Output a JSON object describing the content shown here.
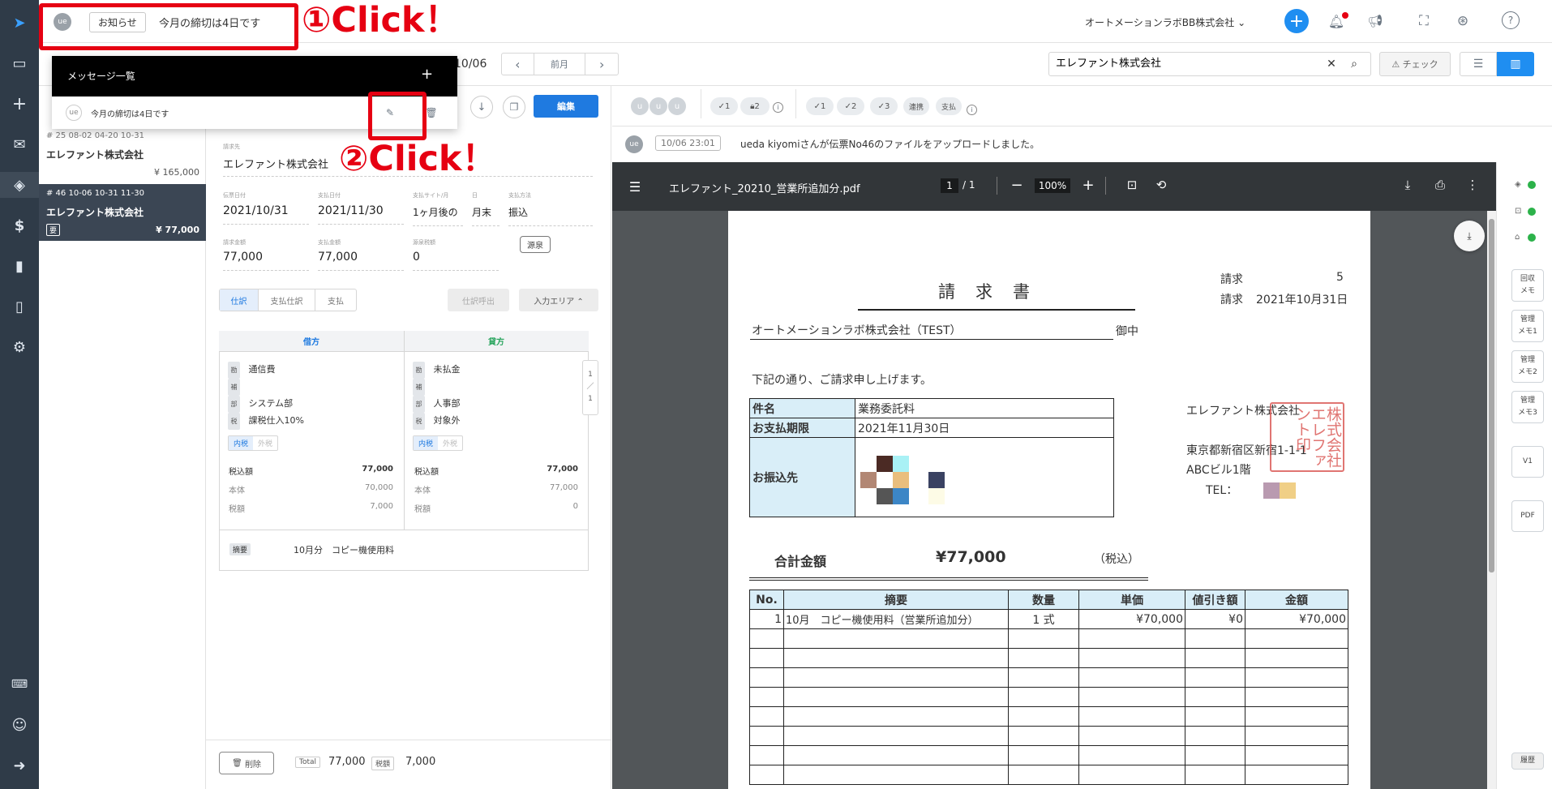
{
  "top": {
    "user_initials": "ue",
    "notice_label": "お知らせ",
    "notice_text": "今月の締切は4日です",
    "company": "オートメーションラボBB株式会社",
    "add": "+"
  },
  "annotations": {
    "click1": "①Click！",
    "click2": "②Click！"
  },
  "message_popup": {
    "title": "メッセージ一覧",
    "add": "+",
    "item_initials": "ue",
    "item_text": "今月の締切は4日です"
  },
  "toolbar": {
    "date_fragment": "10/06",
    "prev": "‹",
    "prev_month": "前月",
    "next": "›",
    "search_value": "エレファント株式会社",
    "check": "チェック",
    "edit": "編集"
  },
  "list": {
    "items": [
      {
        "meta": "# 25  08-02  04-20  10-31",
        "name": "エレファント株式会社",
        "amount": "¥ 165,000"
      },
      {
        "meta": "# 46  10-06  10-31  11-30",
        "name": "エレファント株式会社",
        "tag": "要",
        "amount": "¥ 77,000"
      }
    ]
  },
  "form": {
    "client_label": "請求先",
    "client": "エレファント株式会社",
    "invoice_date_label": "伝票日付",
    "invoice_date": "2021/10/31",
    "pay_date_label": "支払日付",
    "pay_date": "2021/11/30",
    "site_label": "支払サイト/月",
    "site": "1ヶ月後の",
    "day_label": "日",
    "day": "月末",
    "method_label": "支払方法",
    "method": "振込",
    "bill_amount_label": "請求金額",
    "bill_amount": "77,000",
    "pay_amount_label": "支払金額",
    "pay_amount": "77,000",
    "withholding_label": "源泉税額",
    "withholding": "0",
    "source_btn": "源泉",
    "tabs": [
      "仕訳",
      "支払仕訳",
      "支払"
    ],
    "pull_btn": "仕訳呼出",
    "input_area": "入力エリア ⌃",
    "debit_header": "借方",
    "credit_header": "貸方",
    "debit": {
      "account": "通信費",
      "sub": "",
      "dept": "システム部",
      "tax": "課税仕入10%",
      "tax_in": "内税",
      "tax_out": "外税",
      "total_label": "税込額",
      "total": "77,000",
      "base_label": "本体",
      "base": "70,000",
      "tax_label": "税額",
      "tax_amt": "7,000"
    },
    "credit": {
      "account": "未払金",
      "sub": "",
      "dept": "人事部",
      "tax": "対象外",
      "tax_in": "内税",
      "tax_out": "外税",
      "total_label": "税込額",
      "total": "77,000",
      "base_label": "本体",
      "base": "77,000",
      "tax_label": "税額",
      "tax_amt": "0"
    },
    "badge_acc": "勘",
    "badge_sub": "補",
    "badge_dept": "部",
    "badge_tax": "税",
    "page_ind": [
      "1",
      "／",
      "1"
    ],
    "summary_badge": "摘要",
    "summary": "10月分　コピー機使用料"
  },
  "footer": {
    "delete": "削除",
    "total_label": "Total",
    "total": "77,000",
    "tax_label": "税額",
    "tax": "7,000"
  },
  "status": {
    "avatars": [
      "u",
      "u",
      "u"
    ],
    "c1": "1",
    "c2": "2",
    "d1": "1",
    "d2": "2",
    "d3": "3",
    "renkei": "連携",
    "shiharai": "支払"
  },
  "log": {
    "initials": "ue",
    "time": "10/06 23:01",
    "text": "ueda kiyomiさんが伝票No46のファイルをアップロードしました。"
  },
  "pdf": {
    "filename": "エレファント_20210_営業所追加分.pdf",
    "page": "1",
    "pages": "/ 1",
    "zoom": "100%"
  },
  "invoice": {
    "title": "請　求　書",
    "no_label": "請求",
    "no": "5",
    "date_label": "請求",
    "date": "2021年10月31日",
    "to": "オートメーションラボ株式会社（TEST）",
    "honorific": "御中",
    "intro": "下記の通り、ご請求申し上げます。",
    "subject_label": "件名",
    "subject": "業務委託料",
    "due_label": "お支払期限",
    "due": "2021年11月30日",
    "bank_label": "お振込先",
    "issuer": "エレファント株式会社",
    "addr1": "東京都新宿区新宿1-1-1",
    "addr2": "ABCビル1階",
    "tel": "TEL：",
    "seal": "株式会社エレファント印",
    "total_label": "合計金額",
    "total": "¥77,000",
    "tax_note": "（税込）",
    "headers": [
      "No.",
      "摘要",
      "数量",
      "単価",
      "値引き額",
      "金額"
    ],
    "rows": [
      [
        "1",
        "10月　コピー機使用料（営業所追加分）",
        "1 式",
        "¥70,000",
        "¥0",
        "¥70,000"
      ]
    ]
  },
  "right_panel": {
    "memo": [
      "回収\nメモ",
      "管理\nメモ1",
      "管理\nメモ2",
      "管理\nメモ3"
    ],
    "v1": "V1",
    "pdf": "PDF",
    "history": "履歴"
  }
}
